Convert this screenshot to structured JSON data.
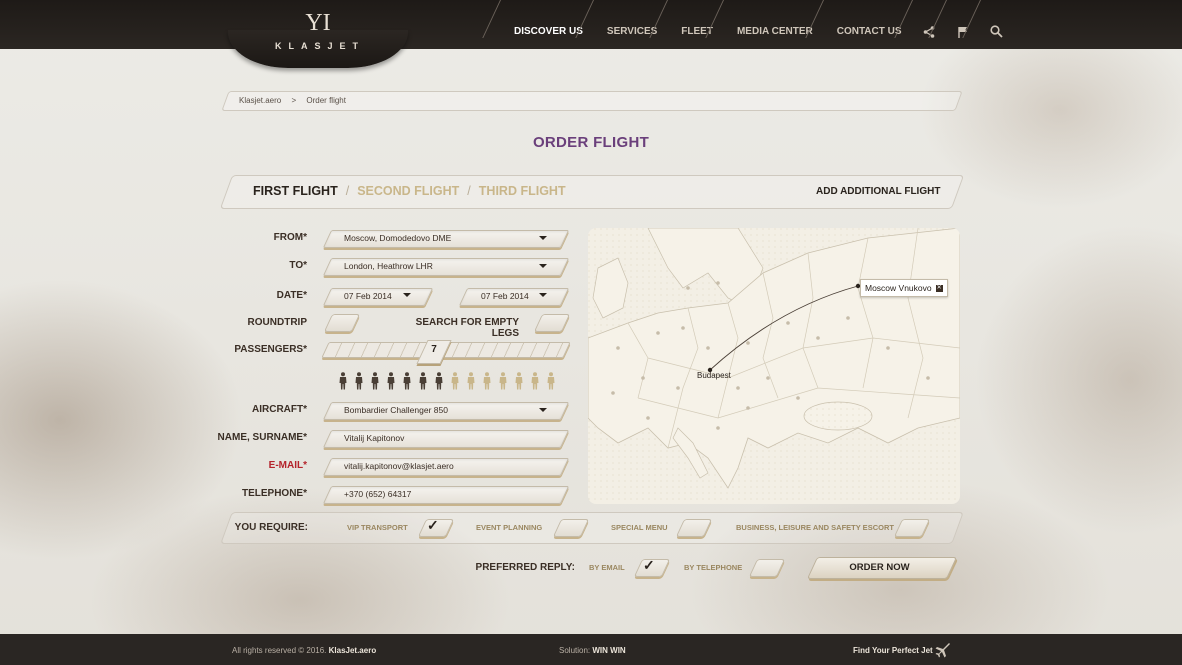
{
  "brand": {
    "logo_text": "KLASJET",
    "logo_mark": "YI"
  },
  "nav": {
    "items": [
      {
        "label": "DISCOVER US"
      },
      {
        "label": "SERVICES"
      },
      {
        "label": "FLEET"
      },
      {
        "label": "MEDIA CENTER"
      },
      {
        "label": "CONTACT US"
      }
    ],
    "icons": [
      "share-icon",
      "flag-icon",
      "search-icon"
    ]
  },
  "breadcrumb": {
    "home": "Klasjet.aero",
    "separator": ">",
    "current": "Order flight"
  },
  "page_title": "ORDER FLIGHT",
  "tabs": {
    "items": [
      {
        "label": "FIRST FLIGHT"
      },
      {
        "label": "SECOND FLIGHT"
      },
      {
        "label": "THIRD FLIGHT"
      }
    ],
    "separator": "/",
    "add_label": "ADD ADDITIONAL FLIGHT"
  },
  "form": {
    "from": {
      "label": "FROM*",
      "value": "Moscow, Domodedovo DME"
    },
    "to": {
      "label": "TO*",
      "value": "London, Heathrow LHR"
    },
    "date": {
      "label": "DATE*",
      "departure": "07 Feb 2014",
      "return": "07 Feb 2014"
    },
    "roundtrip": {
      "label": "ROUNDTRIP",
      "checked": false
    },
    "empty_legs": {
      "label": "SEARCH FOR EMPTY LEGS",
      "checked": false
    },
    "passengers": {
      "label": "PASSENGERS*",
      "value": "7",
      "selected": 7,
      "max": 14
    },
    "aircraft": {
      "label": "AIRCRAFT*",
      "value": "Bombardier Challenger 850"
    },
    "name": {
      "label": "NAME, SURNAME*",
      "value": "Vitalij Kapitonov"
    },
    "email": {
      "label": "E-MAIL*",
      "value": "vitalij.kapitonov@klasjet.aero"
    },
    "telephone": {
      "label": "TELEPHONE*",
      "value": "+370 (652) 64317"
    }
  },
  "map": {
    "origin": "Moscow Vnukovo",
    "destination": "Budapest",
    "close_glyph": "✕"
  },
  "require": {
    "label": "YOU REQUIRE:",
    "options": [
      {
        "label": "VIP TRANSPORT",
        "checked": true
      },
      {
        "label": "EVENT PLANNING",
        "checked": false
      },
      {
        "label": "SPECIAL MENU",
        "checked": false
      },
      {
        "label": "BUSINESS, LEISURE AND SAFETY ESCORT",
        "checked": false
      }
    ]
  },
  "reply": {
    "label": "PREFERRED REPLY:",
    "by_email": "BY EMAIL",
    "by_email_checked": true,
    "by_telephone": "BY TELEPHONE",
    "by_telephone_checked": false
  },
  "order_button": "ORDER NOW",
  "checkmark": "✓",
  "footer": {
    "rights": "All rights reserved © 2016.",
    "site": "KlasJet.aero",
    "solution_label": "Solution:",
    "solution_value": "WIN WIN",
    "find_jet": "Find Your Perfect Jet"
  },
  "colors": {
    "title_purple": "#6a3f7b",
    "required_red": "#b4232b",
    "tab_inactive": "#c9b68a",
    "person_filled": "#4a3f36",
    "person_empty": "#c9b68a"
  }
}
